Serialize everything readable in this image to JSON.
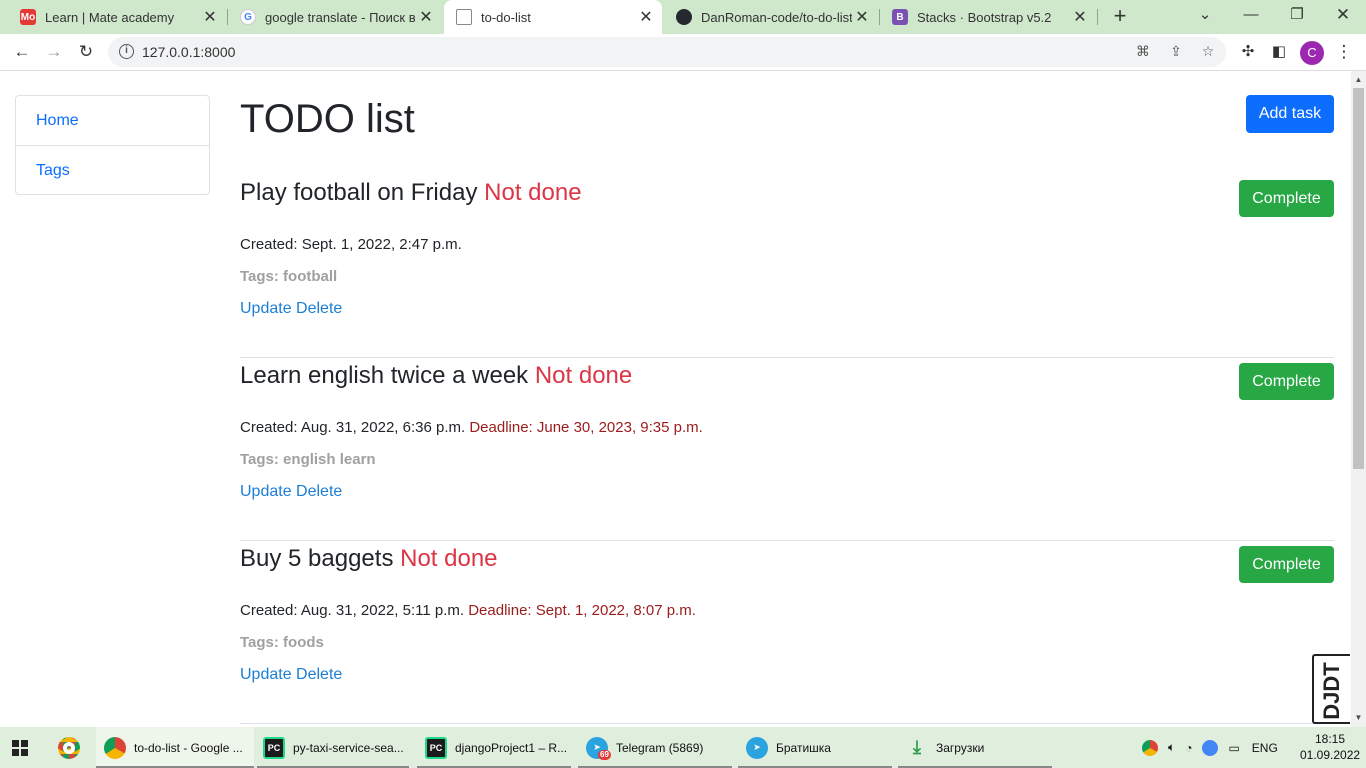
{
  "browser": {
    "tabs": [
      {
        "title": "Learn | Mate academy",
        "favicon": "mate-academy-icon",
        "favicon_text": "Mo",
        "color": "#e53935"
      },
      {
        "title": "google translate - Поиск в Google",
        "favicon": "google-icon",
        "favicon_text": "G",
        "color": "#4285f4"
      },
      {
        "title": "to-do-list",
        "favicon": "page-icon",
        "favicon_text": "",
        "color": "#5f6368"
      },
      {
        "title": "DanRoman-code/to-do-list: Management",
        "favicon": "github-icon",
        "favicon_text": "",
        "color": "#24292f"
      },
      {
        "title": "Stacks · Bootstrap v5.2",
        "favicon": "bootstrap-icon",
        "favicon_text": "B",
        "color": "#7952b3"
      }
    ],
    "active_tab": 2,
    "url": "127.0.0.1:8000",
    "profile_initial": "C"
  },
  "sidebar": {
    "items": [
      {
        "label": "Home"
      },
      {
        "label": "Tags"
      }
    ]
  },
  "main": {
    "title": "TODO list",
    "add_button": "Add task",
    "tasks": [
      {
        "title": "Play football on Friday",
        "status": "Not done",
        "created": "Created: Sept. 1, 2022, 2:47 p.m.",
        "deadline": "",
        "tags": "Tags: football",
        "complete": "Complete",
        "update": "Update",
        "delete": "Delete"
      },
      {
        "title": "Learn english twice a week",
        "status": "Not done",
        "created": "Created: Aug. 31, 2022, 6:36 p.m.",
        "deadline": "Deadline: June 30, 2023, 9:35 p.m.",
        "tags": "Tags: english learn",
        "complete": "Complete",
        "update": "Update",
        "delete": "Delete"
      },
      {
        "title": "Buy 5 baggets",
        "status": "Not done",
        "created": "Created: Aug. 31, 2022, 5:11 p.m.",
        "deadline": "Deadline: Sept. 1, 2022, 8:07 p.m.",
        "tags": "Tags: foods",
        "complete": "Complete",
        "update": "Update",
        "delete": "Delete"
      }
    ]
  },
  "debug_toolbar": {
    "label": "DJDT"
  },
  "taskbar": {
    "items": [
      {
        "label": "to-do-list - Google ...",
        "icon": "chrome-icon",
        "color": "#4caf50"
      },
      {
        "label": "py-taxi-service-sea...",
        "icon": "pycharm-icon",
        "color": "#1b1b1b"
      },
      {
        "label": "djangoProject1 – R...",
        "icon": "pycharm-icon",
        "color": "#1b1b1b"
      },
      {
        "label": "Telegram (5869)",
        "icon": "telegram-icon",
        "color": "#2aa3de",
        "badge": "69"
      },
      {
        "label": "Братишка",
        "icon": "telegram-icon",
        "color": "#2aa3de"
      },
      {
        "label": "Загрузки",
        "icon": "download-icon",
        "color": "#2e9e4f"
      }
    ],
    "language": "ENG",
    "time": "18:15",
    "date": "01.09.2022"
  },
  "colors": {
    "primary": "#0d6efd",
    "success": "#28a745",
    "danger": "#dc3545",
    "deadline": "#9b1c1c",
    "muted": "#a0a0a0"
  }
}
